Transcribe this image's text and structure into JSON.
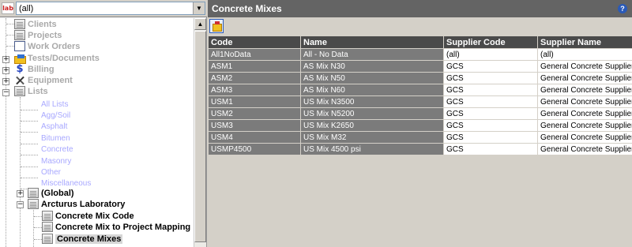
{
  "app": {
    "logo_text": "lab"
  },
  "filter": {
    "value": "(all)"
  },
  "tree": {
    "clients": "Clients",
    "projects": "Projects",
    "work_orders": "Work Orders",
    "tests_documents": "Tests/Documents",
    "billing": "Billing",
    "equipment": "Equipment",
    "lists": "Lists",
    "list_children": [
      "All Lists",
      "Agg/Soil",
      "Asphalt",
      "Bitumen",
      "Concrete",
      "Masonry",
      "Other",
      "Miscellaneous"
    ],
    "global": "(Global)",
    "lab": "Arcturus Laboratory",
    "lab_children": [
      "Concrete Mix Code",
      "Concrete Mix to Project Mapping",
      "Concrete Mixes"
    ]
  },
  "panel": {
    "title": "Concrete Mixes",
    "help": "?"
  },
  "grid": {
    "columns": [
      "Code",
      "Name",
      "Supplier Code",
      "Supplier Name"
    ],
    "rows": [
      [
        "All1NoData",
        "All - No Data",
        "(all)",
        "(all)"
      ],
      [
        "ASM1",
        "AS Mix N30",
        "GCS",
        "General Concrete Supplier"
      ],
      [
        "ASM2",
        "AS Mix N50",
        "GCS",
        "General Concrete Supplier"
      ],
      [
        "ASM3",
        "AS Mix N60",
        "GCS",
        "General Concrete Supplier"
      ],
      [
        "USM1",
        "US Mix N3500",
        "GCS",
        "General Concrete Supplier"
      ],
      [
        "USM2",
        "US Mix N5200",
        "GCS",
        "General Concrete Supplier"
      ],
      [
        "USM3",
        "US Mix K2650",
        "GCS",
        "General Concrete Supplier"
      ],
      [
        "USM4",
        "US Mix M32",
        "GCS",
        "General Concrete Supplier"
      ],
      [
        "USMP4500",
        "US Mix 4500 psi",
        "GCS",
        "General Concrete Supplier"
      ]
    ]
  }
}
